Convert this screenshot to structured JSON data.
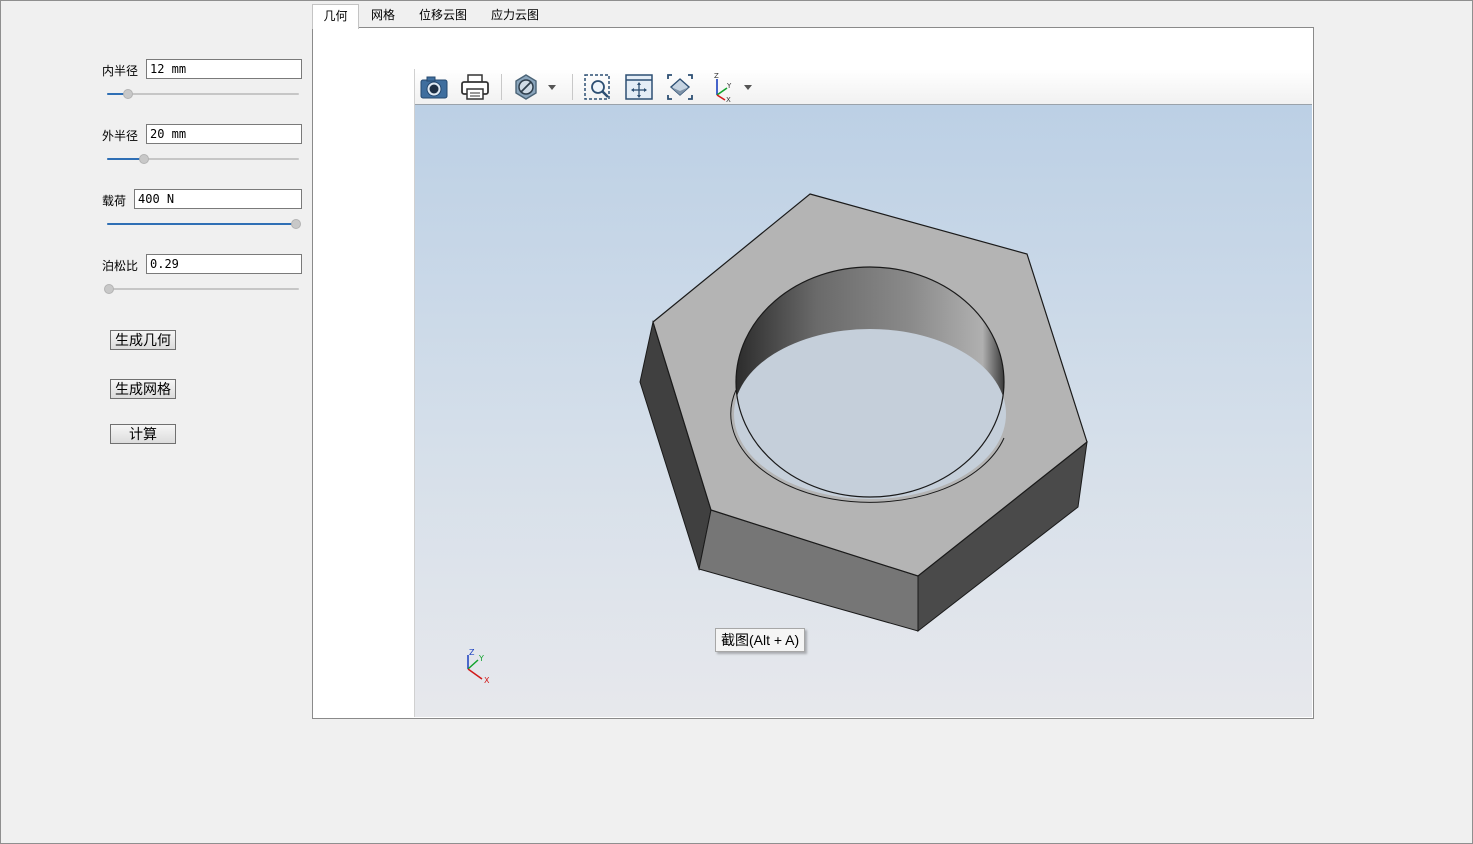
{
  "params": [
    {
      "label": "内半径",
      "value": "12 mm",
      "slider_fraction": 0.1
    },
    {
      "label": "外半径",
      "value": "20 mm",
      "slider_fraction": 0.19
    },
    {
      "label": "载荷",
      "value": "400 N",
      "slider_fraction": 1.0
    },
    {
      "label": "泊松比",
      "value": "0.29",
      "slider_fraction": 0.0
    }
  ],
  "buttons": {
    "generate_geometry": "生成几何",
    "generate_mesh": "生成网格",
    "compute": "计算"
  },
  "tabs": [
    {
      "label": "几何",
      "active": true
    },
    {
      "label": "网格",
      "active": false
    },
    {
      "label": "位移云图",
      "active": false
    },
    {
      "label": "应力云图",
      "active": false
    }
  ],
  "viewer": {
    "toolbar_icons": [
      "camera-icon",
      "printer-icon",
      "section-plane-icon",
      "dropdown-arrow-icon",
      "zoom-window-icon",
      "pan-icon",
      "fit-all-icon",
      "axes-view-icon",
      "dropdown-arrow-icon"
    ],
    "tooltip": "截图(Alt + A)",
    "triad_labels": {
      "x": "X",
      "y": "Y",
      "z": "Z"
    },
    "colors": {
      "background_top": "#bcd0e5",
      "background_bottom": "#e7e8ec",
      "model_top_face": "#b4b4b4",
      "model_side_face": "#4a4a4a"
    }
  }
}
